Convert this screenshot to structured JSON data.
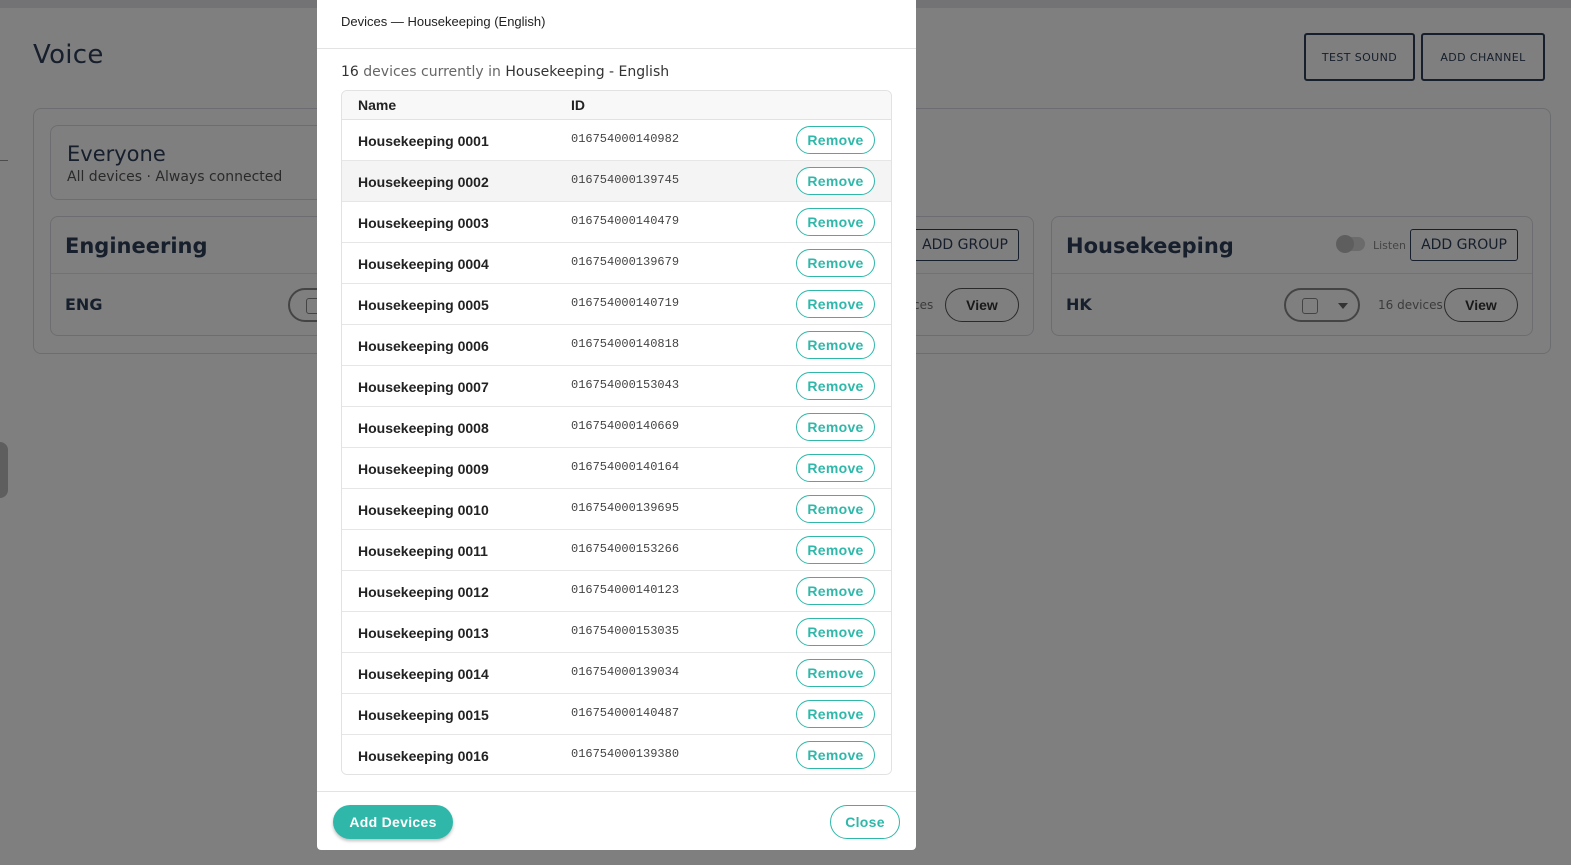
{
  "background": {
    "page_title": "Voice",
    "header_buttons": {
      "test_sound": "TEST SOUND",
      "add_channel": "ADD CHANNEL"
    },
    "everyone": {
      "title": "Everyone",
      "subtitle": "All devices · Always connected"
    },
    "groups": {
      "engineering": {
        "name": "Engineering",
        "code": "ENG"
      },
      "middle": {
        "add_group": "ADD GROUP",
        "count_fragment": "ces",
        "view": "View"
      },
      "housekeeping": {
        "name": "Housekeeping",
        "listen": "Listen",
        "add_group": "ADD GROUP",
        "code": "HK",
        "count": "16 devices",
        "view": "View"
      }
    }
  },
  "modal": {
    "title": "Devices — Housekeeping (English)",
    "summary": {
      "count": "16",
      "text": "devices currently in",
      "group": "Housekeeping - English"
    },
    "columns": {
      "name": "Name",
      "id": "ID"
    },
    "remove_label": "Remove",
    "devices": [
      {
        "name": "Housekeeping 0001",
        "id": "016754000140982"
      },
      {
        "name": "Housekeeping 0002",
        "id": "016754000139745"
      },
      {
        "name": "Housekeeping 0003",
        "id": "016754000140479"
      },
      {
        "name": "Housekeeping 0004",
        "id": "016754000139679"
      },
      {
        "name": "Housekeeping 0005",
        "id": "016754000140719"
      },
      {
        "name": "Housekeeping 0006",
        "id": "016754000140818"
      },
      {
        "name": "Housekeeping 0007",
        "id": "016754000153043"
      },
      {
        "name": "Housekeeping 0008",
        "id": "016754000140669"
      },
      {
        "name": "Housekeeping 0009",
        "id": "016754000140164"
      },
      {
        "name": "Housekeeping 0010",
        "id": "016754000139695"
      },
      {
        "name": "Housekeeping 0011",
        "id": "016754000153266"
      },
      {
        "name": "Housekeeping 0012",
        "id": "016754000140123"
      },
      {
        "name": "Housekeeping 0013",
        "id": "016754000153035"
      },
      {
        "name": "Housekeeping 0014",
        "id": "016754000139034"
      },
      {
        "name": "Housekeeping 0015",
        "id": "016754000140487"
      },
      {
        "name": "Housekeeping 0016",
        "id": "016754000139380"
      }
    ],
    "footer": {
      "add_devices": "Add Devices",
      "close": "Close"
    }
  },
  "colors": {
    "accent": "#2fb8aa",
    "navy": "#2c3e56",
    "overlay": "#000000"
  }
}
